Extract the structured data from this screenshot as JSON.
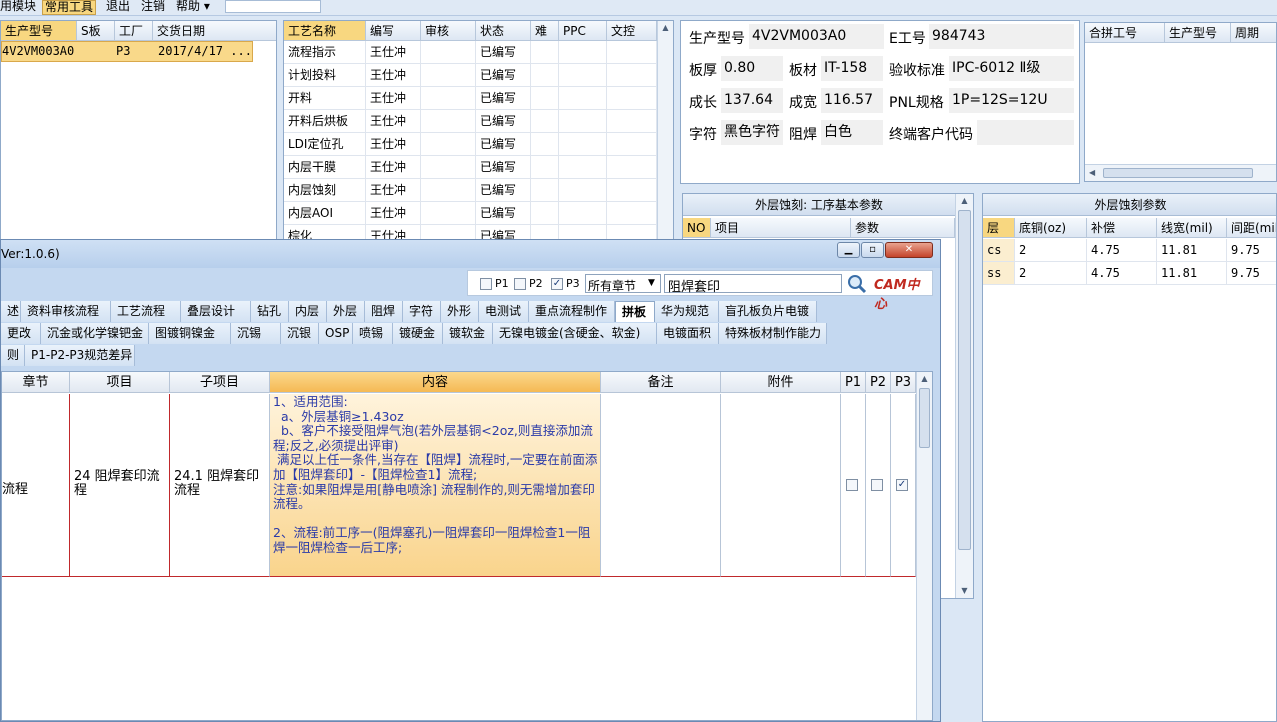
{
  "menubar": {
    "items": [
      "用模块",
      "常用工具",
      "退出",
      "注销",
      "帮助 ▾"
    ],
    "active_index": 1
  },
  "top_left": {
    "headers": [
      "生产型号",
      "S板",
      "工厂",
      "交货日期"
    ],
    "row": [
      "4V2VM003A0",
      "",
      "P3",
      "2017/4/17 ..."
    ]
  },
  "process_grid": {
    "headers": [
      "工艺名称",
      "编写",
      "审核",
      "状态",
      "难",
      "PPC",
      "文控"
    ],
    "rows": [
      [
        "流程指示",
        "王仕冲",
        "",
        "已编写"
      ],
      [
        "计划投料",
        "王仕冲",
        "",
        "已编写"
      ],
      [
        "开料",
        "王仕冲",
        "",
        "已编写"
      ],
      [
        "开料后烘板",
        "王仕冲",
        "",
        "已编写"
      ],
      [
        "LDI定位孔",
        "王仕冲",
        "",
        "已编写"
      ],
      [
        "内层干膜",
        "王仕冲",
        "",
        "已编写"
      ],
      [
        "内层蚀刻",
        "王仕冲",
        "",
        "已编写"
      ],
      [
        "内层AOI",
        "王仕冲",
        "",
        "已编写"
      ],
      [
        "棕化",
        "王仕冲",
        "",
        "已编写"
      ]
    ]
  },
  "info": {
    "model_label": "生产型号",
    "model_value": "4V2VM003A0",
    "e_label": "E工号",
    "e_value": "984743",
    "thickness_label": "板厚",
    "thickness_value": "0.80",
    "material_label": "板材",
    "material_value": "IT-158",
    "standard_label": "验收标准",
    "standard_value": "IPC-6012 Ⅱ级",
    "length_label": "成长",
    "length_value": "137.64",
    "width_label": "成宽",
    "width_value": "116.57",
    "pnl_label": "PNL规格",
    "pnl_value": "1P=12S=12U",
    "char_label": "字符",
    "char_value": "黑色字符",
    "mask_label": "阻焊",
    "mask_value": "白色",
    "customer_label": "终端客户代码",
    "customer_value": ""
  },
  "right_grid": {
    "headers": [
      "合拼工号",
      "生产型号",
      "周期"
    ]
  },
  "etch_basic": {
    "title": "外层蚀刻: 工序基本参数",
    "headers": [
      "NO",
      "项目",
      "参数"
    ]
  },
  "etch_params": {
    "title": "外层蚀刻参数",
    "headers": [
      "层",
      "底铜(oz)",
      "补偿",
      "线宽(mil)",
      "间距(mil"
    ],
    "rows": [
      [
        "cs",
        "2",
        "4.75",
        "11.81",
        "9.75"
      ],
      [
        "ss",
        "2",
        "4.75",
        "11.81",
        "9.75"
      ]
    ]
  },
  "window": {
    "title": "Ver:1.0.6)",
    "search": {
      "p1": "P1",
      "p2": "P2",
      "p3": "P3",
      "chapter": "所有章节",
      "query": "阻焊套印",
      "brand": "CAM中心"
    },
    "tabs_row1": [
      "述",
      "资料审核流程",
      "工艺流程",
      "叠层设计",
      "钻孔",
      "内层",
      "外层",
      "阻焊",
      "字符",
      "外形",
      "电测试",
      "重点流程制作",
      "拼板",
      "华为规范",
      "盲孔板负片电镀"
    ],
    "tabs_row2": [
      "更改",
      "沉金或化学镍钯金",
      "图镀铜镍金",
      "沉锡",
      "沉银",
      "OSP",
      "喷锡",
      "镀硬金",
      "镀软金",
      "无镍电镀金(含硬金、软金)",
      "电镀面积",
      "特殊板材制作能力"
    ],
    "tabs_row3": [
      "则",
      "P1-P2-P3规范差异"
    ],
    "selected_tab": "拼板",
    "grid": {
      "headers": [
        "章节",
        "项目",
        "子项目",
        "内容",
        "备注",
        "附件",
        "P1",
        "P2",
        "P3"
      ],
      "row": {
        "chapter": "流程",
        "item": "24 阻焊套印流程",
        "subitem": "24.1 阻焊套印流程",
        "content": [
          "1、适用范围:",
          "  a、外层基铜≥1.43oz",
          "  b、客户不接受阻焊气泡(若外层基铜<2oz,则直接添加流程;反之,必须提出评审)",
          " 满足以上任一条件,当存在【阻焊】流程时,一定要在前面添加【阻焊套印】-【阻焊检查1】流程;",
          "注意:如果阻焊是用[静电喷涂] 流程制作的,则无需增加套印流程。",
          "",
          "2、流程:前工序一(阻焊塞孔)一阻焊套印一阻焊检查1一阻焊一阻焊检查一后工序;"
        ],
        "note": "",
        "attachment": "",
        "p1": false,
        "p2": false,
        "p3": true
      }
    }
  },
  "colors": {
    "accent": "#f8d780",
    "highlight": "#f9c877",
    "selection": "#c4d8f0"
  }
}
